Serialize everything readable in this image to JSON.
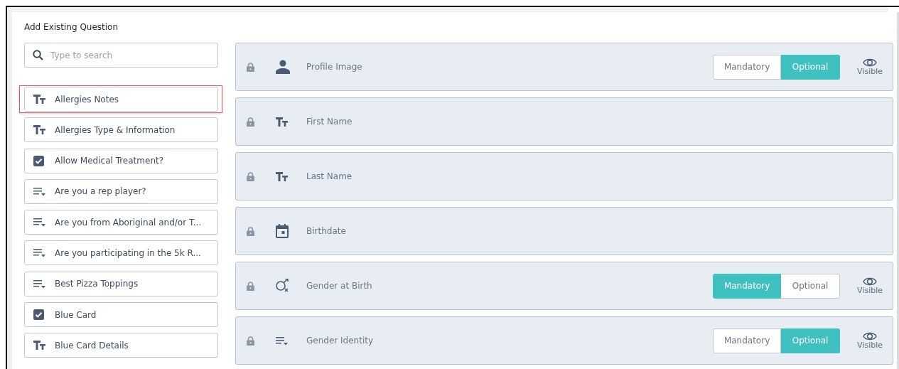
{
  "heading": "Add Existing Question",
  "search": {
    "placeholder": "Type to search"
  },
  "questions": [
    {
      "kind": "text",
      "label": "Allergies Notes",
      "highlighted": true
    },
    {
      "kind": "text",
      "label": "Allergies Type & Information",
      "highlighted": false
    },
    {
      "kind": "checkbox",
      "label": "Allow Medical Treatment?",
      "highlighted": false
    },
    {
      "kind": "dropdown",
      "label": "Are you a rep player?",
      "highlighted": false
    },
    {
      "kind": "dropdown",
      "label": "Are you from Aboriginal and/or T...",
      "highlighted": false
    },
    {
      "kind": "dropdown",
      "label": "Are you participating in the 5k R...",
      "highlighted": false
    },
    {
      "kind": "dropdown",
      "label": "Best Pizza Toppings",
      "highlighted": false
    },
    {
      "kind": "checkbox",
      "label": "Blue Card",
      "highlighted": false
    },
    {
      "kind": "text",
      "label": "Blue Card Details",
      "highlighted": false
    }
  ],
  "fields": [
    {
      "kind": "person",
      "label": "Profile Image",
      "options": [
        {
          "label": "Mandatory",
          "selected": false
        },
        {
          "label": "Optional",
          "selected": true
        }
      ],
      "visibility": "Visible"
    },
    {
      "kind": "text",
      "label": "First Name"
    },
    {
      "kind": "text",
      "label": "Last Name"
    },
    {
      "kind": "calendar",
      "label": "Birthdate"
    },
    {
      "kind": "gender",
      "label": "Gender at Birth",
      "options": [
        {
          "label": "Mandatory",
          "selected": true
        },
        {
          "label": "Optional",
          "selected": false
        }
      ],
      "visibility": "Visible"
    },
    {
      "kind": "dropdown",
      "label": "Gender Identity",
      "options": [
        {
          "label": "Mandatory",
          "selected": false
        },
        {
          "label": "Optional",
          "selected": true
        }
      ],
      "visibility": "Visible"
    }
  ]
}
